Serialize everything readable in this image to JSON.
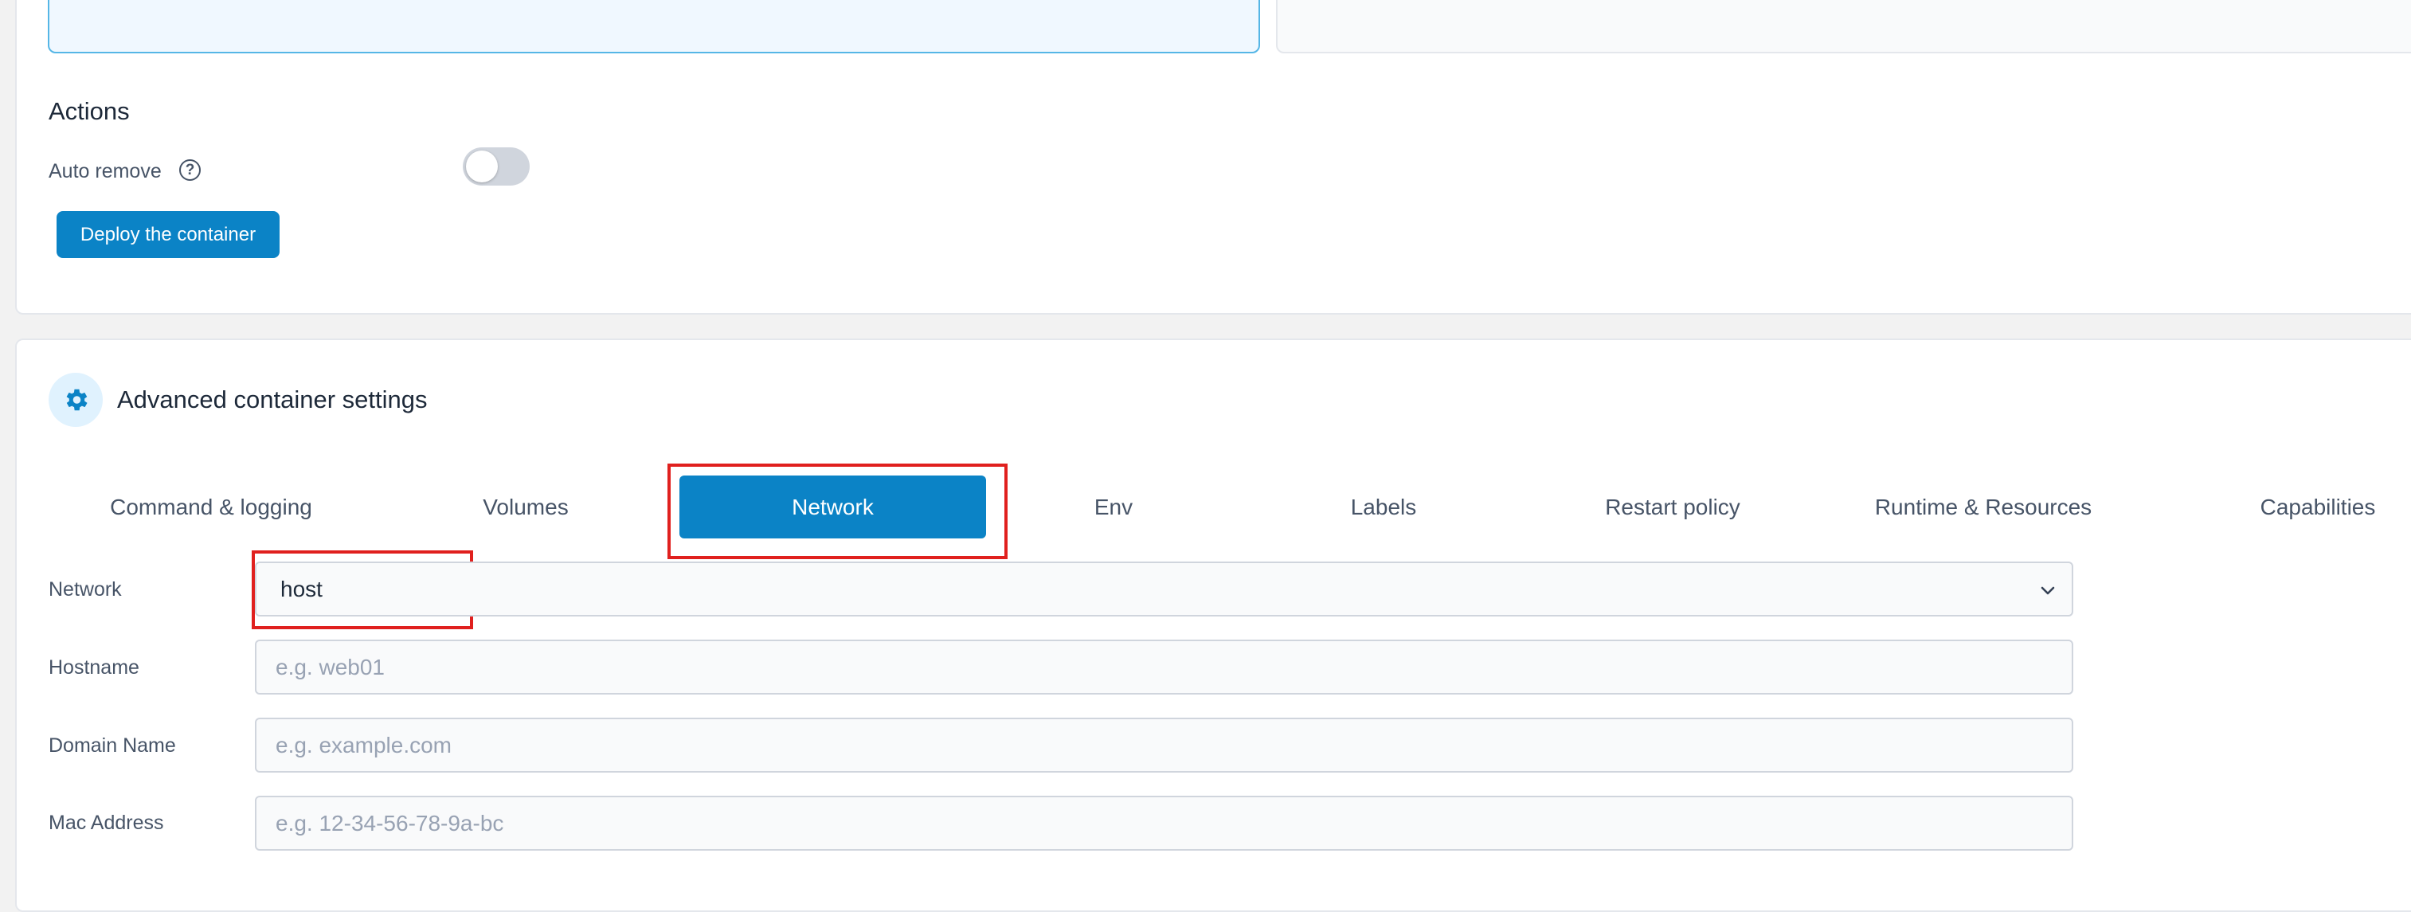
{
  "actions": {
    "title": "Actions",
    "auto_remove_label": "Auto remove",
    "auto_remove_enabled": false,
    "deploy_label": "Deploy the container"
  },
  "advanced": {
    "title": "Advanced container settings",
    "tabs": [
      {
        "label": "Command & logging",
        "active": false
      },
      {
        "label": "Volumes",
        "active": false
      },
      {
        "label": "Network",
        "active": true
      },
      {
        "label": "Env",
        "active": false
      },
      {
        "label": "Labels",
        "active": false
      },
      {
        "label": "Restart policy",
        "active": false
      },
      {
        "label": "Runtime & Resources",
        "active": false
      },
      {
        "label": "Capabilities",
        "active": false
      }
    ]
  },
  "network_form": {
    "network_label": "Network",
    "network_value": "host",
    "hostname_label": "Hostname",
    "hostname_placeholder": "e.g. web01",
    "domain_label": "Domain Name",
    "domain_placeholder": "e.g. example.com",
    "mac_label": "Mac Address",
    "mac_placeholder": "e.g. 12-34-56-78-9a-bc"
  },
  "colors": {
    "accent": "#0b83c6",
    "highlight": "#e0201e"
  }
}
